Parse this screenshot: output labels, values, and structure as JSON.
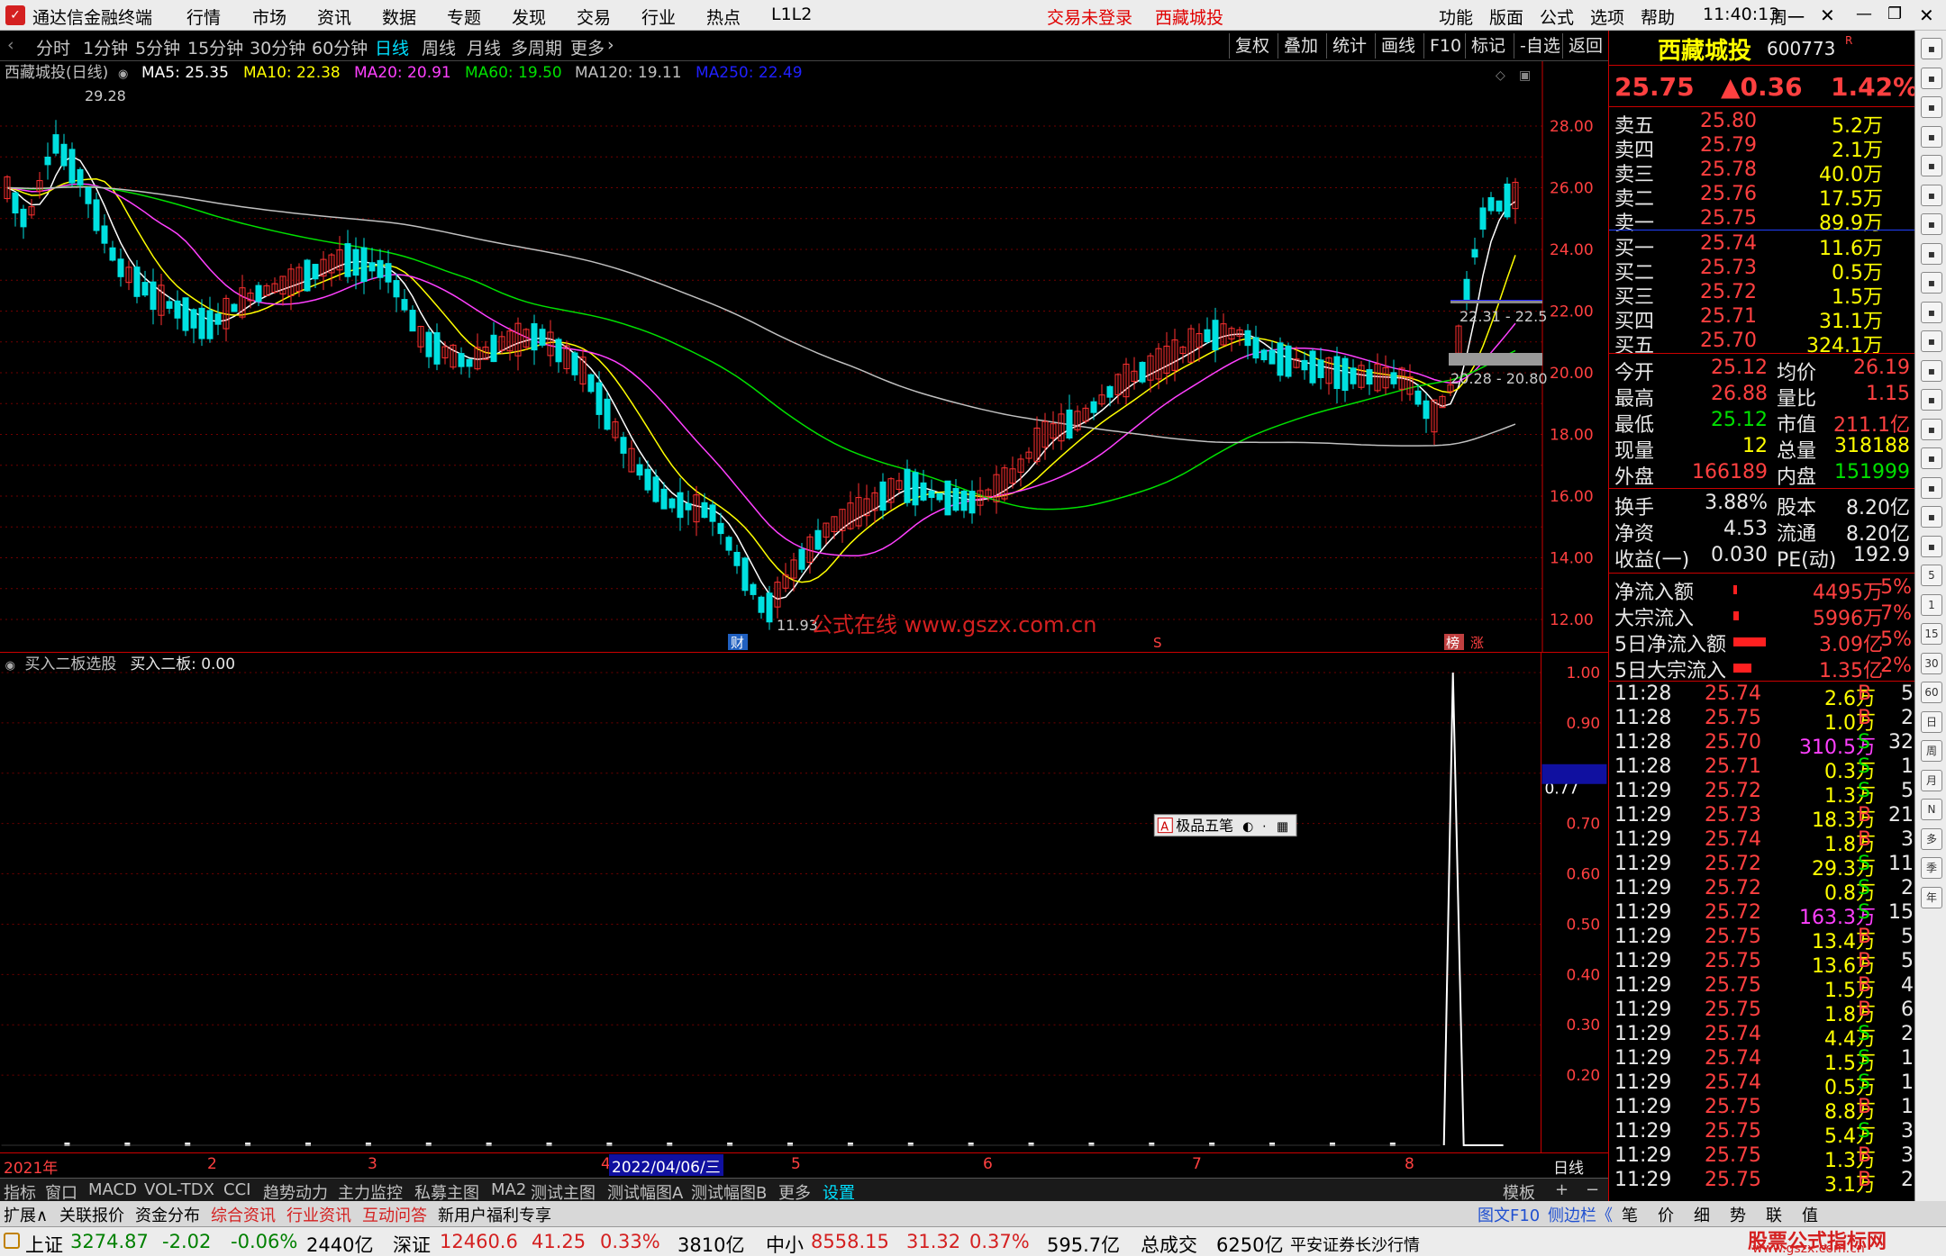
{
  "titlebar": {
    "app_title": "通达信金融终端",
    "menus": [
      "行情",
      "市场",
      "资讯",
      "数据",
      "专题",
      "发现",
      "交易",
      "行业",
      "热点",
      "L1L2"
    ],
    "trade_status": "交易未登录",
    "stock_name": "西藏城投",
    "right_menus": [
      "功能",
      "版面",
      "公式",
      "选项",
      "帮助"
    ],
    "time": "11:40:13",
    "weekday": "周一"
  },
  "periods": [
    "分时",
    "1分钟",
    "5分钟",
    "15分钟",
    "30分钟",
    "60分钟",
    "日线",
    "周线",
    "月线",
    "多周期",
    "更多"
  ],
  "active_period": "日线",
  "tools": [
    "复权",
    "叠加",
    "统计",
    "画线",
    "F10",
    "标记",
    "-自选",
    "返回"
  ],
  "ma_legend": {
    "title": "西藏城投(日线)",
    "items": [
      {
        "label": "MA5: 25.35",
        "color": "#ffffff"
      },
      {
        "label": "MA10: 22.38",
        "color": "#ffff00"
      },
      {
        "label": "MA20: 20.91",
        "color": "#ff40ff"
      },
      {
        "label": "MA60: 19.50",
        "color": "#00e000"
      },
      {
        "label": "MA120: 19.11",
        "color": "#c0c0c0"
      },
      {
        "label": "MA250: 22.49",
        "color": "#2020ff"
      }
    ]
  },
  "price_axis": [
    "28.00",
    "26.00",
    "24.00",
    "22.00",
    "20.00",
    "18.00",
    "16.00",
    "14.00",
    "12.00"
  ],
  "annotations": {
    "high": "29.28",
    "low": "11.93",
    "watermark": "公式在线 www.gszx.com.cn",
    "box1": "22.31 - 22.5",
    "box2": "20.28 - 20.80",
    "fin_tag": "财",
    "s_tag": "S",
    "bang": "榜",
    "zhang": "涨"
  },
  "sub_legend": {
    "name": "买入二板选股",
    "value": "买入二板: 0.00"
  },
  "sub_axis": [
    "1.00",
    "0.90",
    "0.77",
    "0.70",
    "0.60",
    "0.50",
    "0.40",
    "0.30",
    "0.20"
  ],
  "float_toolbar": "极品五笔",
  "dates": {
    "start": "2021年",
    "m2": "2",
    "m3": "3",
    "m4": "4",
    "cursor": "2022/04/06/三",
    "m5": "5",
    "m6": "6",
    "m7": "7",
    "m8": "8",
    "period": "日线"
  },
  "tabs_row1": [
    "指标",
    "窗口",
    "MACD",
    "VOL-TDX",
    "CCI",
    "趋势动力",
    "主力监控",
    "私募主图",
    "MA2",
    "测试主图",
    "测试幅图A",
    "测试幅图B",
    "更多",
    "设置"
  ],
  "tabs_row1_right": [
    "模板",
    "+",
    "−"
  ],
  "tabs_row2": [
    "扩展∧",
    "关联报价",
    "资金分布",
    "综合资讯",
    "行业资讯",
    "互动问答",
    "新用户福利专享"
  ],
  "tabs_row2_right": [
    "图文F10",
    "侧边栏《",
    "笔",
    "价",
    "细",
    "势",
    "联",
    "值"
  ],
  "quote": {
    "name": "西藏城投",
    "code": "600773",
    "price": "25.75",
    "change": "▲0.36",
    "pct": "1.42%",
    "asks": [
      {
        "label": "卖五",
        "price": "25.80",
        "vol": "5.2万"
      },
      {
        "label": "卖四",
        "price": "25.79",
        "vol": "2.1万"
      },
      {
        "label": "卖三",
        "price": "25.78",
        "vol": "40.0万"
      },
      {
        "label": "卖二",
        "price": "25.76",
        "vol": "17.5万"
      },
      {
        "label": "卖一",
        "price": "25.75",
        "vol": "89.9万"
      }
    ],
    "bids": [
      {
        "label": "买一",
        "price": "25.74",
        "vol": "11.6万"
      },
      {
        "label": "买二",
        "price": "25.73",
        "vol": "0.5万"
      },
      {
        "label": "买三",
        "price": "25.72",
        "vol": "1.5万"
      },
      {
        "label": "买四",
        "price": "25.71",
        "vol": "31.1万"
      },
      {
        "label": "买五",
        "price": "25.70",
        "vol": "324.1万"
      }
    ],
    "stats": [
      [
        "今开",
        "25.12",
        "均价",
        "26.19"
      ],
      [
        "最高",
        "26.88",
        "量比",
        "1.15"
      ],
      [
        "最低",
        "25.12",
        "市值",
        "211.1亿"
      ],
      [
        "现量",
        "12",
        "总量",
        "318188"
      ],
      [
        "外盘",
        "166189",
        "内盘",
        "151999"
      ]
    ],
    "stats2": [
      [
        "换手",
        "3.88%",
        "股本",
        "8.20亿"
      ],
      [
        "净资",
        "4.53",
        "流通",
        "8.20亿"
      ],
      [
        "收益(一)",
        "0.030",
        "PE(动)",
        "192.9"
      ]
    ],
    "flows": [
      [
        "净流入额",
        "4495万",
        "5%"
      ],
      [
        "大宗流入",
        "5996万",
        "7%"
      ],
      [
        "5日净流入额",
        "3.09亿",
        "5%"
      ],
      [
        "5日大宗流入",
        "1.35亿",
        "2%"
      ]
    ]
  },
  "ticks": [
    [
      "11:28",
      "25.74",
      "2.6万",
      "B",
      "5"
    ],
    [
      "11:28",
      "25.75",
      "1.0万",
      "B",
      "2"
    ],
    [
      "11:28",
      "25.70",
      "310.5万",
      "S",
      "32"
    ],
    [
      "11:28",
      "25.71",
      "0.3万",
      "S",
      "1"
    ],
    [
      "11:29",
      "25.72",
      "1.3万",
      "S",
      "5"
    ],
    [
      "11:29",
      "25.73",
      "18.3万",
      "B",
      "21"
    ],
    [
      "11:29",
      "25.74",
      "1.8万",
      "B",
      "3"
    ],
    [
      "11:29",
      "25.72",
      "29.3万",
      "S",
      "11"
    ],
    [
      "11:29",
      "25.72",
      "0.8万",
      "S",
      "2"
    ],
    [
      "11:29",
      "25.72",
      "163.3万",
      "S",
      "15"
    ],
    [
      "11:29",
      "25.75",
      "13.4万",
      "B",
      "5"
    ],
    [
      "11:29",
      "25.75",
      "13.6万",
      "B",
      "5"
    ],
    [
      "11:29",
      "25.75",
      "1.5万",
      "B",
      "4"
    ],
    [
      "11:29",
      "25.75",
      "1.8万",
      "B",
      "6"
    ],
    [
      "11:29",
      "25.74",
      "4.4万",
      "S",
      "2"
    ],
    [
      "11:29",
      "25.74",
      "1.5万",
      "S",
      "1"
    ],
    [
      "11:29",
      "25.74",
      "0.5万",
      "S",
      "1"
    ],
    [
      "11:29",
      "25.75",
      "8.8万",
      "B",
      "1"
    ],
    [
      "11:29",
      "25.75",
      "5.4万",
      "S",
      "3"
    ],
    [
      "11:29",
      "25.75",
      "1.3万",
      "B",
      "3"
    ],
    [
      "11:29",
      "25.75",
      "3.1万",
      "B",
      "2"
    ]
  ],
  "sidebar_icons": [
    "up-icon",
    "down-icon",
    "list-icon",
    "grid-icon",
    "chart-icon",
    "bar-icon",
    "doc-icon",
    "f10-icon",
    "table-icon",
    "info-icon",
    "fin-icon",
    "xi-icon",
    "circle-icon",
    "wave-icon",
    "rsi-icon",
    "alert-icon",
    "move-icon",
    "pen-icon",
    "5",
    "1",
    "15",
    "30",
    "60",
    "日",
    "周",
    "月",
    "N",
    "多",
    "季",
    "年"
  ],
  "status": {
    "sh_name": "上证",
    "sh_val": "3274.87",
    "sh_chg": "-2.02",
    "sh_pct": "-0.06%",
    "sh_amt": "2440亿",
    "sz_name": "深证",
    "sz_val": "12460.6",
    "sz_chg": "41.25",
    "sz_pct": "0.33%",
    "sz_amt": "3810亿",
    "zx_name": "中小",
    "zx_val": "8558.15",
    "zx_chg": "31.32",
    "zx_pct": "0.37%",
    "zx_amt": "595.7亿",
    "total_label": "总成交",
    "total": "6250亿",
    "broker": "平安证券长沙行情",
    "site": "股票公式指标网",
    "site_url": "www.gszx.com.cn"
  }
}
